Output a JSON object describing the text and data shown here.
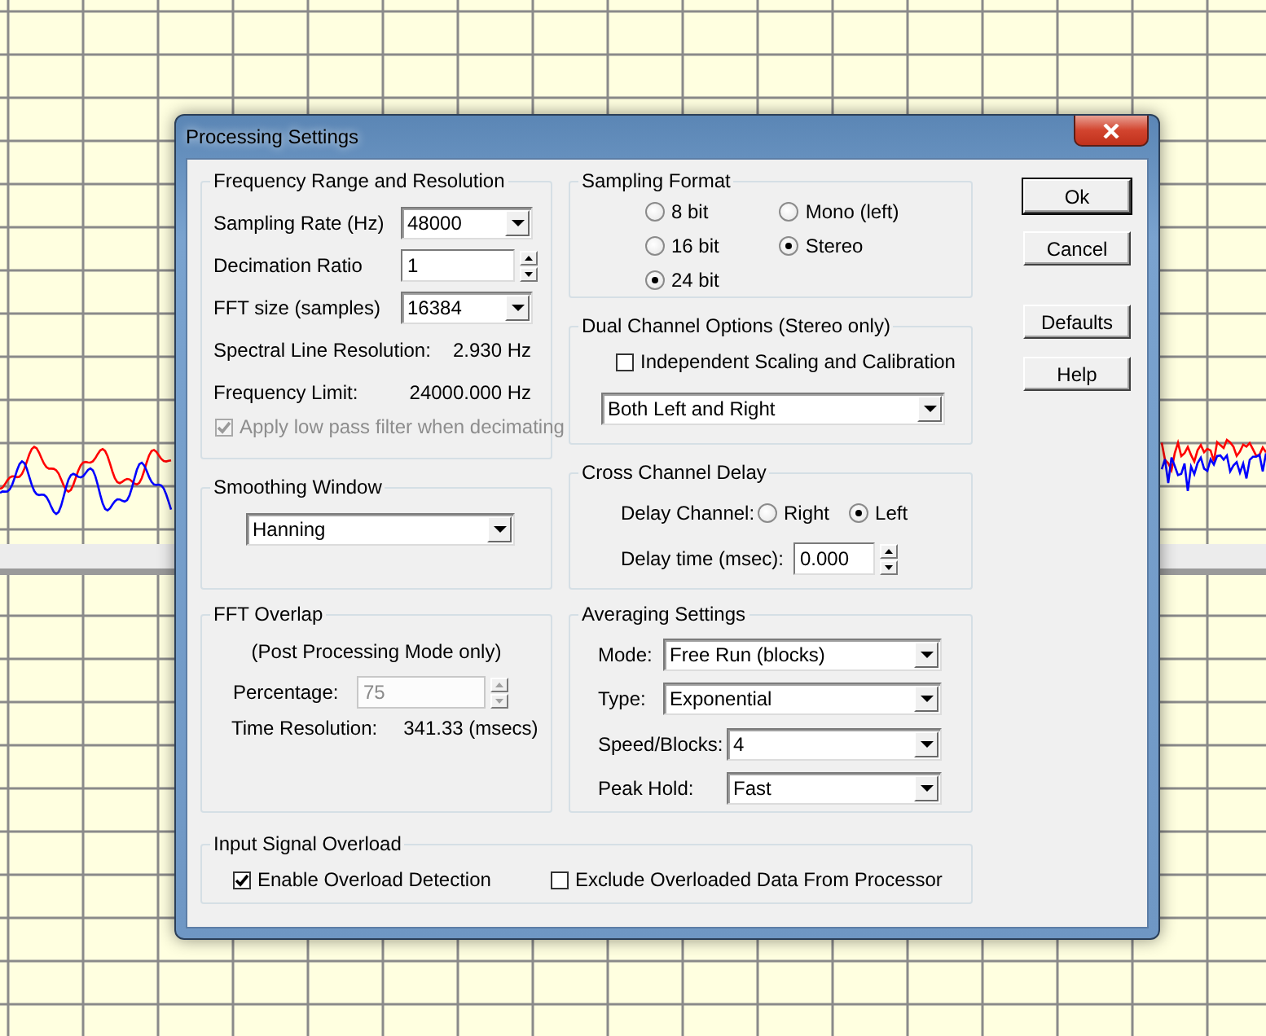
{
  "window": {
    "title": "Processing Settings"
  },
  "frequency_group": {
    "title": "Frequency Range and Resolution",
    "sampling_rate": {
      "label": "Sampling Rate (Hz)",
      "value": "48000"
    },
    "decimation_ratio": {
      "label": "Decimation Ratio",
      "value": "1"
    },
    "fft_size": {
      "label": "FFT size (samples)",
      "value": "16384"
    },
    "spectral_line_resolution": {
      "label": "Spectral Line Resolution:",
      "value": "2.930 Hz"
    },
    "frequency_limit": {
      "label": "Frequency Limit:",
      "value": "24000.000 Hz"
    },
    "low_pass_filter": {
      "label": "Apply low pass filter when decimating",
      "checked": true,
      "disabled": true
    }
  },
  "smoothing_window": {
    "title": "Smoothing Window",
    "value": "Hanning"
  },
  "fft_overlap": {
    "title": "FFT Overlap",
    "note": "(Post Processing Mode only)",
    "percentage": {
      "label": "Percentage:",
      "value": "75",
      "disabled": true
    },
    "time_resolution": {
      "label": "Time Resolution:",
      "value": "341.33 (msecs)"
    }
  },
  "sampling_format": {
    "title": "Sampling Format",
    "bit_depth": [
      {
        "label": "8 bit",
        "selected": false
      },
      {
        "label": "16 bit",
        "selected": false
      },
      {
        "label": "24 bit",
        "selected": true
      }
    ],
    "channels": [
      {
        "label": "Mono (left)",
        "selected": false
      },
      {
        "label": "Stereo",
        "selected": true
      }
    ]
  },
  "dual_channel": {
    "title": "Dual Channel Options (Stereo only)",
    "independent_scaling": {
      "label": "Independent Scaling and Calibration",
      "checked": false
    },
    "channel_select": {
      "value": "Both Left and Right"
    }
  },
  "cross_channel_delay": {
    "title": "Cross Channel Delay",
    "delay_channel": {
      "label": "Delay Channel:",
      "options": [
        {
          "label": "Right",
          "selected": false
        },
        {
          "label": "Left",
          "selected": true
        }
      ]
    },
    "delay_time": {
      "label": "Delay time (msec):",
      "value": "0.000"
    }
  },
  "averaging": {
    "title": "Averaging Settings",
    "fields": [
      {
        "label": "Mode:",
        "value": "Free Run (blocks)",
        "kind": "wide"
      },
      {
        "label": "Type:",
        "value": "Exponential",
        "kind": "wide"
      },
      {
        "label": "Speed/Blocks:",
        "value": "4",
        "kind": "narrow"
      },
      {
        "label": "Peak Hold:",
        "value": "Fast",
        "kind": "narrow"
      }
    ]
  },
  "input_overload": {
    "title": "Input Signal Overload",
    "options": [
      {
        "label": "Enable Overload Detection",
        "checked": true
      },
      {
        "label": "Exclude Overloaded Data From Processor",
        "checked": false
      }
    ]
  },
  "button_groups": [
    {
      "buttons": [
        {
          "label": "Ok",
          "default": true
        },
        {
          "label": "Cancel",
          "default": false
        }
      ]
    },
    {
      "buttons": [
        {
          "label": "Defaults",
          "default": false
        },
        {
          "label": "Help",
          "default": false
        }
      ]
    }
  ]
}
